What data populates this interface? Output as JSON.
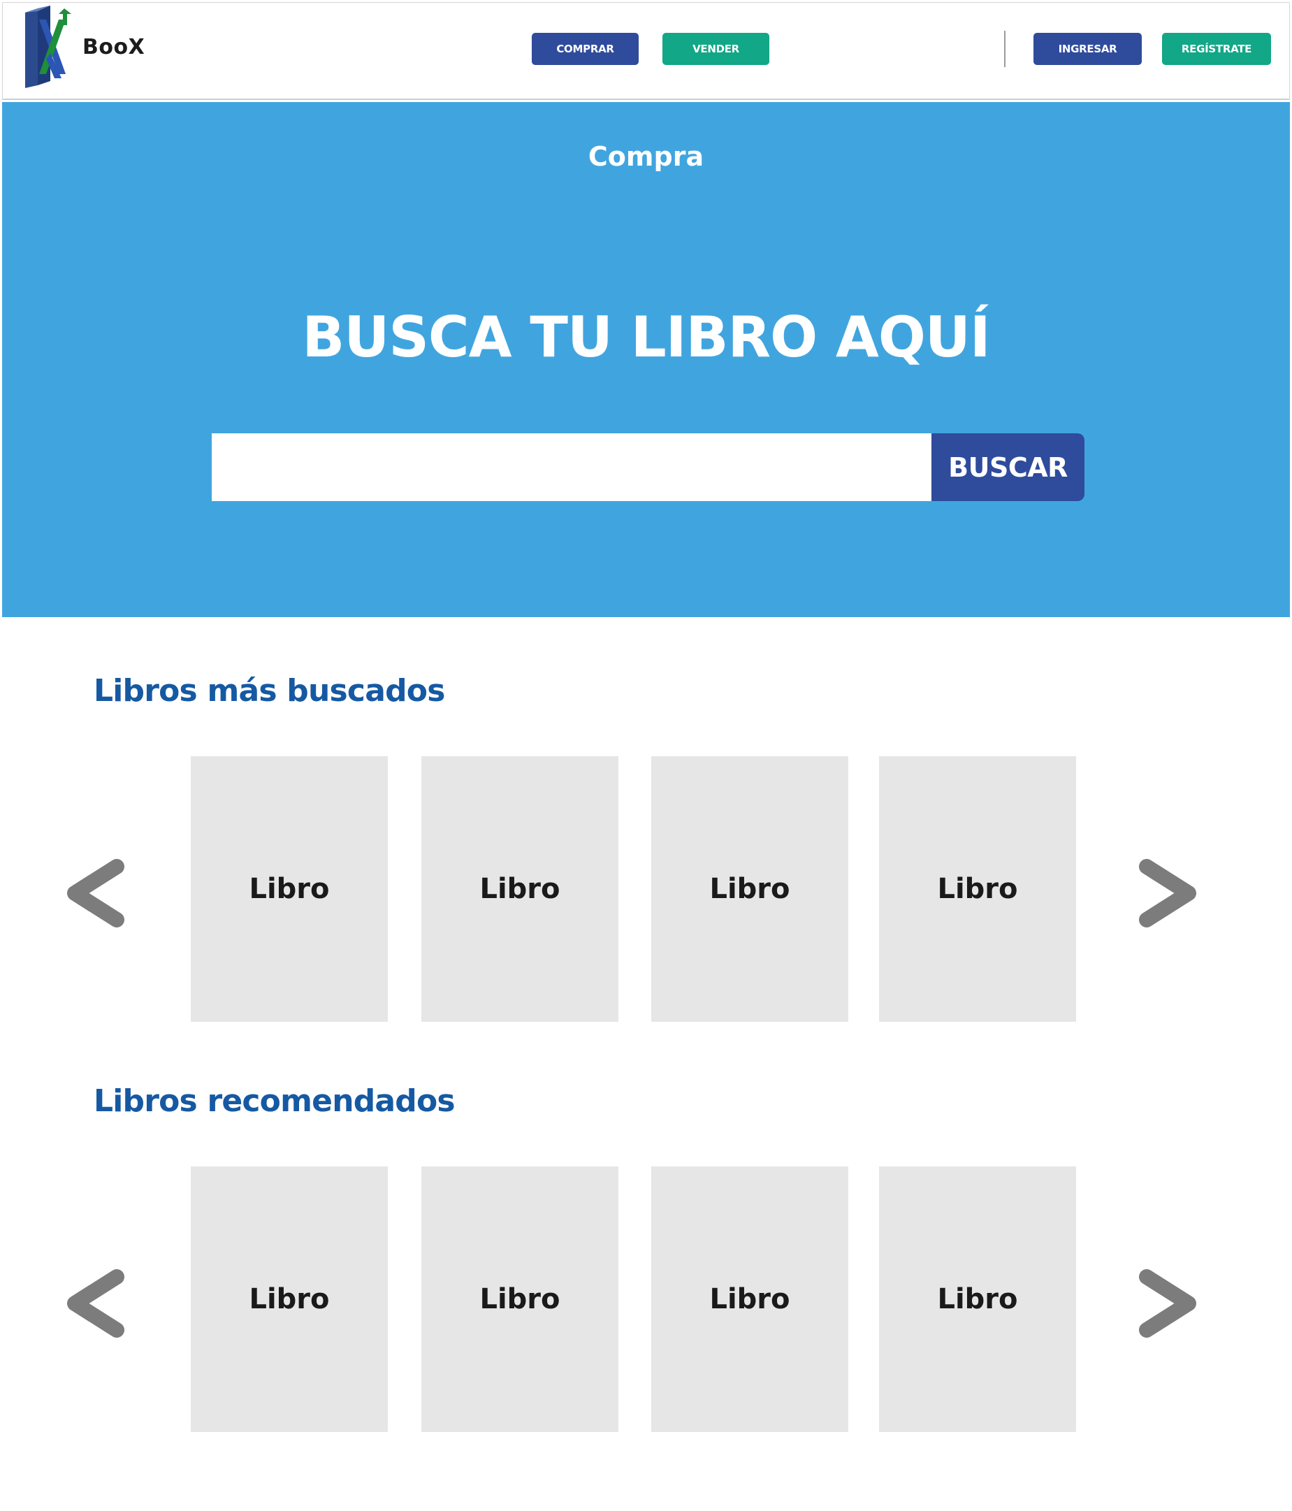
{
  "header": {
    "brand": "BooX",
    "nav": {
      "comprar": "COMPRAR",
      "vender": "VENDER",
      "ingresar": "INGRESAR",
      "registrate": "REGÍSTRATE"
    }
  },
  "hero": {
    "subtitle": "Compra",
    "title": "BUSCA TU LIBRO AQUÍ",
    "search": {
      "value": "",
      "placeholder": "",
      "button_label": "BUSCAR"
    }
  },
  "sections": [
    {
      "title": "Libros más buscados",
      "books": [
        "Libro",
        "Libro",
        "Libro",
        "Libro"
      ]
    },
    {
      "title": "Libros recomendados",
      "books": [
        "Libro",
        "Libro",
        "Libro",
        "Libro"
      ]
    }
  ],
  "icons": {
    "logo": "boox-book-logo-icon",
    "prev": "chevron-left-icon",
    "next": "chevron-right-icon"
  },
  "colors": {
    "primary_blue": "#2f4b9c",
    "accent_green": "#12a786",
    "hero_background": "#40a5df",
    "section_title": "#1659a3",
    "card_background": "#e6e6e6",
    "arrow": "#7c7c7c"
  }
}
